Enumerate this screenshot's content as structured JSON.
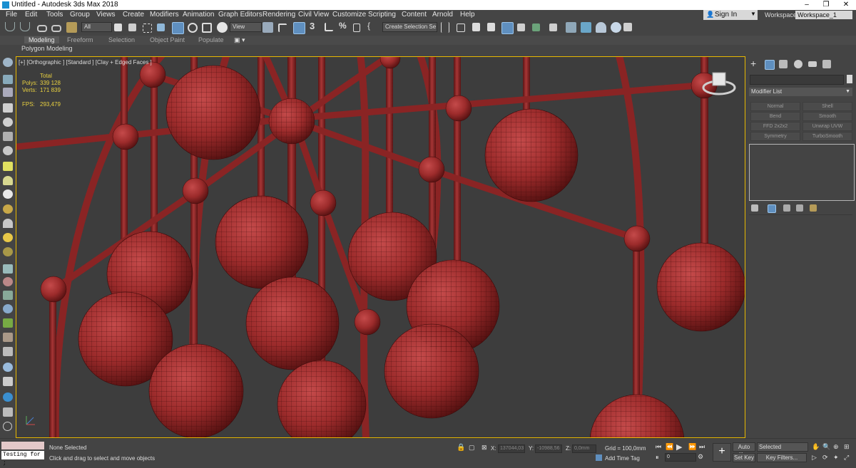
{
  "window": {
    "title": "Untitled - Autodesk 3ds Max 2018",
    "minimize": "–",
    "maximize": "❐",
    "close": "✕"
  },
  "menu": [
    "File",
    "Edit",
    "Tools",
    "Group",
    "Views",
    "Create",
    "Modifiers",
    "Animation",
    "Graph Editors",
    "Rendering",
    "Civil View",
    "Customize",
    "Scripting",
    "Content",
    "Arnold",
    "Help"
  ],
  "account": {
    "sign_in": "Sign In",
    "workspaces_label": "Workspaces:",
    "workspace": "Workspace_1"
  },
  "toolbar": {
    "filter": "All",
    "view": "View",
    "selection_set": "Create Selection Se"
  },
  "ribbon": {
    "tabs": [
      "Modeling",
      "Freeform",
      "Selection",
      "Object Paint",
      "Populate"
    ],
    "active_tab": "Modeling",
    "panel": "Polygon Modeling"
  },
  "viewport": {
    "label": "[+] [Orthographic ] [Standard ] [Clay + Edged Faces ]",
    "stats": {
      "total": "Total",
      "polys_label": "Polys:",
      "polys": "339 128",
      "verts_label": "Verts:",
      "verts": "171 839",
      "fps_label": "FPS:",
      "fps": "293,479"
    }
  },
  "command_panel": {
    "modifier_list": "Modifier List",
    "modifiers": [
      "Normal",
      "Shell",
      "Bend",
      "Smooth",
      "FFD 2x2x2",
      "Unwrap UVW",
      "Symmetry",
      "TurboSmooth"
    ]
  },
  "status": {
    "maxscript": "Testing for ;",
    "selection": "None Selected",
    "prompt": "Click and drag to select and move objects",
    "x_label": "X:",
    "x": "137044,03",
    "y_label": "Y:",
    "y": "-10988,56",
    "z_label": "Z:",
    "z": "0,0mm",
    "grid": "Grid = 100,0mm",
    "add_time_tag": "Add Time Tag",
    "frame": "0",
    "auto_key": "Auto Key",
    "set_key": "Set Key",
    "key_mode": "Selected",
    "key_filters": "Key Filters..."
  },
  "colors": {
    "model": "#9c2b2b",
    "viewport_bg": "#3d3d3d",
    "viewport_border": "#e8b800",
    "stats": "#e8d040"
  }
}
